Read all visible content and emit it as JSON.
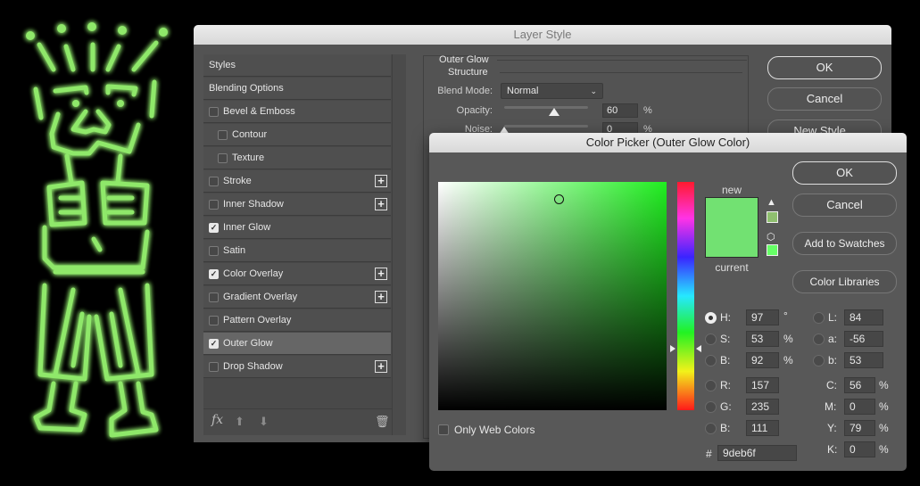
{
  "background_art": {
    "description": "neon green glowing line drawing of a cartoon figure",
    "glow_color": "#9deb6f"
  },
  "layer_style": {
    "title": "Layer Style",
    "styles_list": [
      {
        "label": "Styles",
        "checkbox": false,
        "checked": false,
        "plus": false,
        "indent": false,
        "selected": false
      },
      {
        "label": "Blending Options",
        "checkbox": false,
        "checked": false,
        "plus": false,
        "indent": false,
        "selected": false
      },
      {
        "label": "Bevel & Emboss",
        "checkbox": true,
        "checked": false,
        "plus": false,
        "indent": false,
        "selected": false
      },
      {
        "label": "Contour",
        "checkbox": true,
        "checked": false,
        "plus": false,
        "indent": true,
        "selected": false
      },
      {
        "label": "Texture",
        "checkbox": true,
        "checked": false,
        "plus": false,
        "indent": true,
        "selected": false
      },
      {
        "label": "Stroke",
        "checkbox": true,
        "checked": false,
        "plus": true,
        "indent": false,
        "selected": false
      },
      {
        "label": "Inner Shadow",
        "checkbox": true,
        "checked": false,
        "plus": true,
        "indent": false,
        "selected": false
      },
      {
        "label": "Inner Glow",
        "checkbox": true,
        "checked": true,
        "plus": false,
        "indent": false,
        "selected": false
      },
      {
        "label": "Satin",
        "checkbox": true,
        "checked": false,
        "plus": false,
        "indent": false,
        "selected": false
      },
      {
        "label": "Color Overlay",
        "checkbox": true,
        "checked": true,
        "plus": true,
        "indent": false,
        "selected": false
      },
      {
        "label": "Gradient Overlay",
        "checkbox": true,
        "checked": false,
        "plus": true,
        "indent": false,
        "selected": false
      },
      {
        "label": "Pattern Overlay",
        "checkbox": true,
        "checked": false,
        "plus": false,
        "indent": false,
        "selected": false
      },
      {
        "label": "Outer Glow",
        "checkbox": true,
        "checked": true,
        "plus": false,
        "indent": false,
        "selected": true
      },
      {
        "label": "Drop Shadow",
        "checkbox": true,
        "checked": false,
        "plus": true,
        "indent": false,
        "selected": false
      }
    ],
    "footer": {
      "fx_label": "fx",
      "up_icon": "arrow-up-icon",
      "down_icon": "arrow-down-icon",
      "trash_icon": "trash-icon"
    },
    "outer_glow": {
      "section_title": "Outer Glow",
      "group_title": "Structure",
      "blend_mode_label": "Blend Mode:",
      "blend_mode_value": "Normal",
      "opacity_label": "Opacity:",
      "opacity_value": "60",
      "opacity_unit": "%",
      "opacity_fraction": 0.6,
      "noise_label": "Noise:",
      "noise_value": "0",
      "noise_unit": "%",
      "noise_fraction": 0.0
    },
    "buttons": {
      "ok": "OK",
      "cancel": "Cancel",
      "new_style": "New Style..."
    }
  },
  "color_picker": {
    "title": "Color Picker (Outer Glow Color)",
    "buttons": {
      "ok": "OK",
      "cancel": "Cancel",
      "add_to_swatches": "Add to Swatches",
      "color_libraries": "Color Libraries"
    },
    "new_label": "new",
    "current_label": "current",
    "new_color": "#72e172",
    "current_color": "#72e172",
    "gamut_warning_icon": "warning-triangle-icon",
    "gamut_swatch_color": "#8fbf6f",
    "web_safe_icon": "cube-icon",
    "web_safe_swatch_color": "#66ff66",
    "only_web_colors_label": "Only Web Colors",
    "only_web_colors_checked": false,
    "hsb": {
      "h": {
        "label": "H:",
        "value": "97",
        "unit": "°",
        "selected": true
      },
      "s": {
        "label": "S:",
        "value": "53",
        "unit": "%",
        "selected": false
      },
      "b": {
        "label": "B:",
        "value": "92",
        "unit": "%",
        "selected": false
      }
    },
    "rgb": {
      "r": {
        "label": "R:",
        "value": "157"
      },
      "g": {
        "label": "G:",
        "value": "235"
      },
      "b": {
        "label": "B:",
        "value": "111"
      }
    },
    "lab": {
      "l": {
        "label": "L:",
        "value": "84"
      },
      "a": {
        "label": "a:",
        "value": "-56"
      },
      "b": {
        "label": "b:",
        "value": "53"
      }
    },
    "cmyk": {
      "c": {
        "label": "C:",
        "value": "56",
        "unit": "%"
      },
      "m": {
        "label": "M:",
        "value": "0",
        "unit": "%"
      },
      "y": {
        "label": "Y:",
        "value": "79",
        "unit": "%"
      },
      "k": {
        "label": "K:",
        "value": "0",
        "unit": "%"
      }
    },
    "hex_label": "#",
    "hex_value": "9deb6f",
    "hue_position_fraction": 0.73,
    "saturation_fraction": 0.53,
    "brightness_fraction": 0.92
  }
}
